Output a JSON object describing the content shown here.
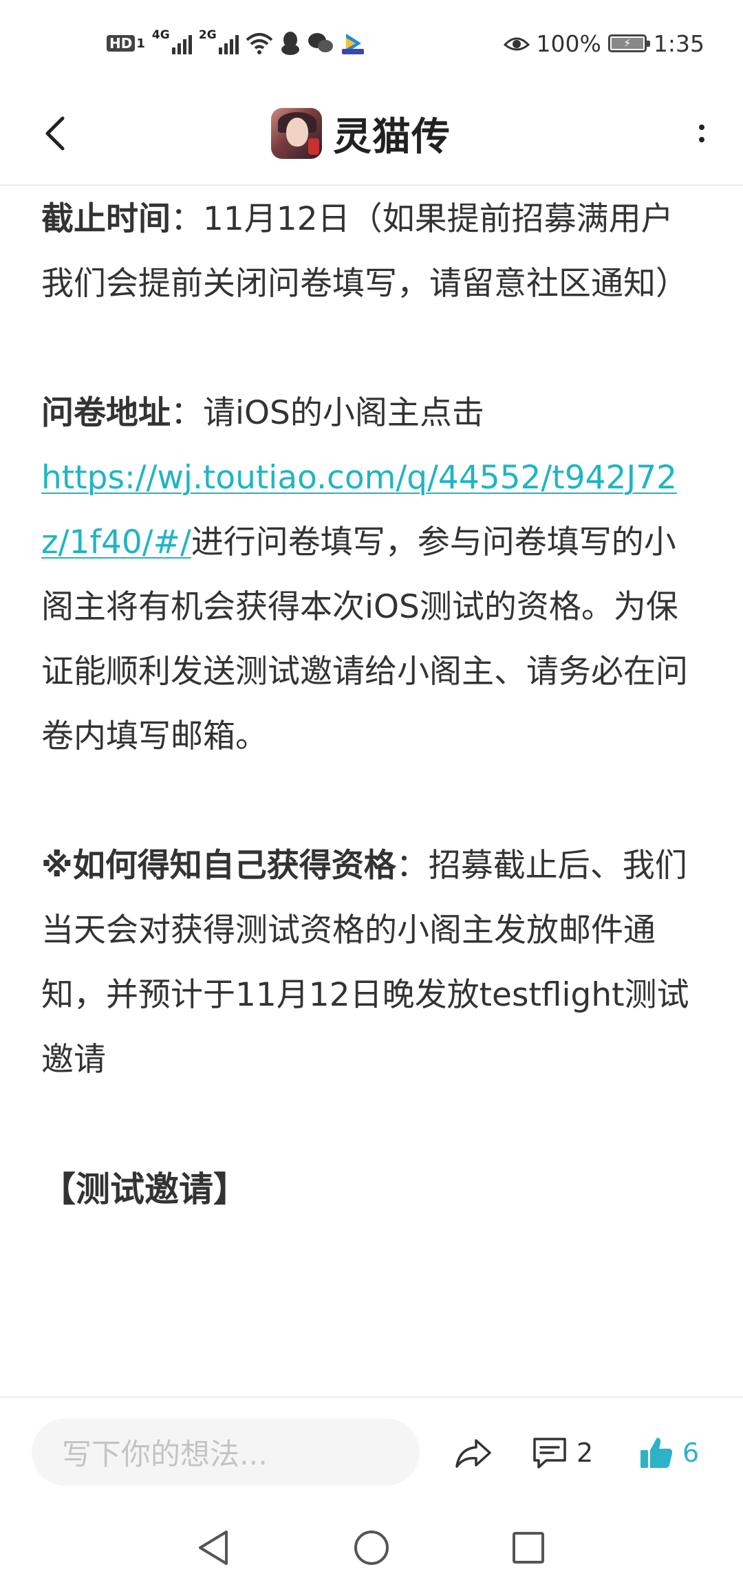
{
  "status_bar": {
    "hd": "HD",
    "sim1": "1",
    "net1": "4G",
    "net2": "2G",
    "battery": "100%",
    "time": "1:35"
  },
  "header": {
    "title": "灵猫传"
  },
  "article": {
    "deadline_label": "截止时间",
    "deadline_text": "：11月12日（如果提前招募满用户我们会提前关闭问卷填写，请留意社区通知）",
    "survey_label": "问卷地址",
    "survey_intro": "：请iOS的小阁主点击",
    "survey_link": "https://wj.toutiao.com/q/44552/t942J72z/1f40/#/",
    "survey_text": "进行问卷填写，参与问卷填写的小阁主将有机会获得本次iOS测试的资格。为保证能顺利发送测试邀请给小阁主、请务必在问卷内填写邮箱。",
    "qualify_label": "※如何得知自己获得资格",
    "qualify_text": "：招募截止后、我们当天会对获得测试资格的小阁主发放邮件通知，并预计于11月12日晚发放testflight测试邀请",
    "section_title": "【测试邀请】"
  },
  "action_bar": {
    "comment_placeholder": "写下你的想法...",
    "comment_count": "2",
    "like_count": "6"
  },
  "colors": {
    "link": "#1fb5c3",
    "like": "#2db3c8"
  }
}
